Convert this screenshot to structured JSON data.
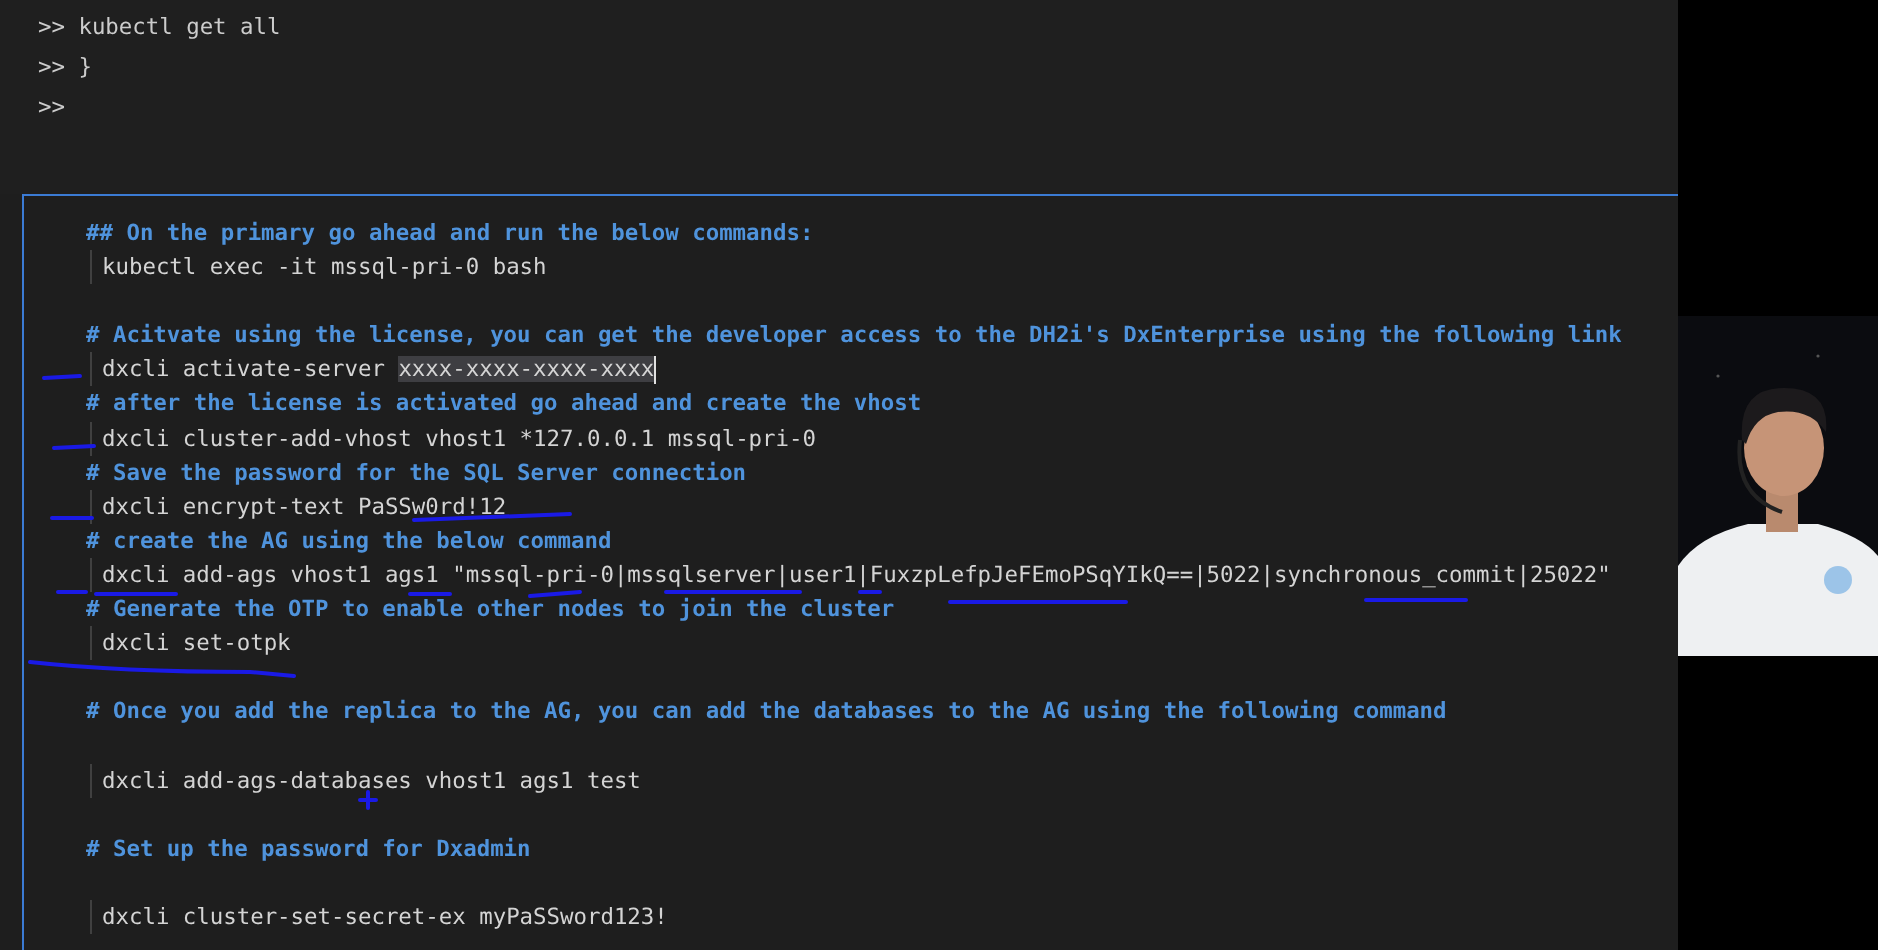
{
  "terminal": {
    "lines": [
      ">> kubectl get all",
      ">> }",
      ">>"
    ]
  },
  "editor": {
    "lines": [
      {
        "kind": "comment",
        "text": "## On the primary go ahead and run the below commands:"
      },
      {
        "kind": "command",
        "text": "kubectl exec -it mssql-pri-0 bash"
      },
      {
        "kind": "blank"
      },
      {
        "kind": "comment",
        "text": "# Acitvate using the license, you can get the developer access to the DH2i's DxEnterprise using the following link"
      },
      {
        "kind": "command",
        "segments": [
          {
            "text": "dxcli activate-server ",
            "selected": false
          },
          {
            "text": "xxxx-xxxx-xxxx-xxxx",
            "selected": true
          }
        ]
      },
      {
        "kind": "comment",
        "text": "# after the license is activated go ahead and create the vhost"
      },
      {
        "kind": "command",
        "text": "dxcli cluster-add-vhost vhost1 *127.0.0.1 mssql-pri-0"
      },
      {
        "kind": "comment",
        "text": "# Save the password for the SQL Server connection"
      },
      {
        "kind": "command",
        "text": "dxcli encrypt-text PaSSw0rd!12"
      },
      {
        "kind": "comment",
        "text": "# create the AG using the below command"
      },
      {
        "kind": "command",
        "text": "dxcli add-ags vhost1 ags1 \"mssql-pri-0|mssqlserver|user1|FuxzpLefpJeFEmoPSqYIkQ==|5022|synchronous_commit|25022\""
      },
      {
        "kind": "comment",
        "text": "# Generate the OTP to enable other nodes to join the cluster"
      },
      {
        "kind": "command",
        "text": "dxcli set-otpk"
      },
      {
        "kind": "blank"
      },
      {
        "kind": "comment",
        "text": "# Once you add the replica to the AG, you can add the databases to the AG using the following command"
      },
      {
        "kind": "blank"
      },
      {
        "kind": "command",
        "text": "dxcli add-ags-databases vhost1 ags1 test"
      },
      {
        "kind": "blank"
      },
      {
        "kind": "comment",
        "text": "# Set up the password for Dxadmin"
      },
      {
        "kind": "blank"
      },
      {
        "kind": "command",
        "text": "dxcli cluster-set-secret-ex myPaSSword123!"
      }
    ]
  }
}
